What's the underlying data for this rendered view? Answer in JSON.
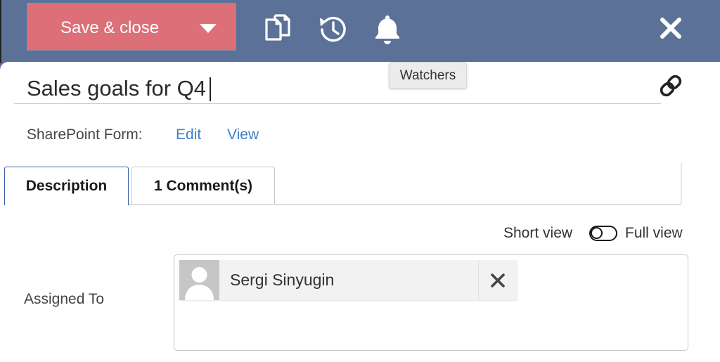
{
  "toolbar": {
    "save_label": "Save & close",
    "icons": [
      "copy-icon",
      "history-icon",
      "bell-icon",
      "close-icon"
    ],
    "save_color": "#dd6f79",
    "bar_color": "#5b7198"
  },
  "tooltip": {
    "text": "Watchers"
  },
  "item": {
    "title": "Sales goals for Q4"
  },
  "sharepoint": {
    "label": "SharePoint Form:",
    "edit": "Edit",
    "view": "View",
    "link_color": "#3f7fc9"
  },
  "tabs": [
    {
      "label": "Description",
      "active": true
    },
    {
      "label": "1 Comment(s)",
      "active": false
    }
  ],
  "view_toggle": {
    "short": "Short view",
    "full": "Full view"
  },
  "assigned": {
    "label": "Assigned To",
    "person": "Sergi Sinyugin"
  }
}
